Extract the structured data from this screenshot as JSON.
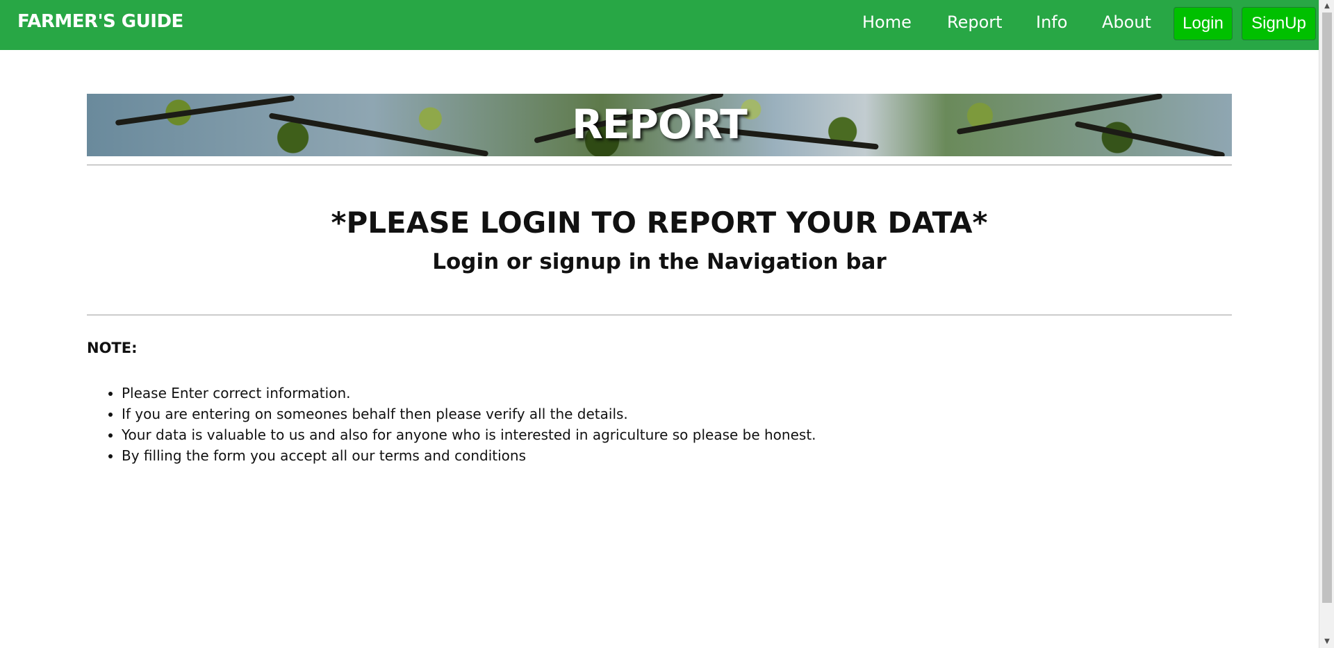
{
  "navbar": {
    "brand": "FARMER'S GUIDE",
    "links": [
      "Home",
      "Report",
      "Info",
      "About"
    ],
    "login_label": "Login",
    "signup_label": "SignUp",
    "color": "#28a745",
    "button_color": "#00c000"
  },
  "banner": {
    "title": "REPORT"
  },
  "main": {
    "heading": "*PLEASE LOGIN TO REPORT YOUR DATA*",
    "subheading": "Login or signup in the Navigation bar"
  },
  "note": {
    "title": "NOTE:",
    "items": [
      "Please Enter correct information.",
      "If you are entering on someones behalf then please verify all the details.",
      "Your data is valuable to us and also for anyone who is interested in agriculture so please be honest.",
      "By filling the form you accept all our terms and conditions"
    ]
  }
}
